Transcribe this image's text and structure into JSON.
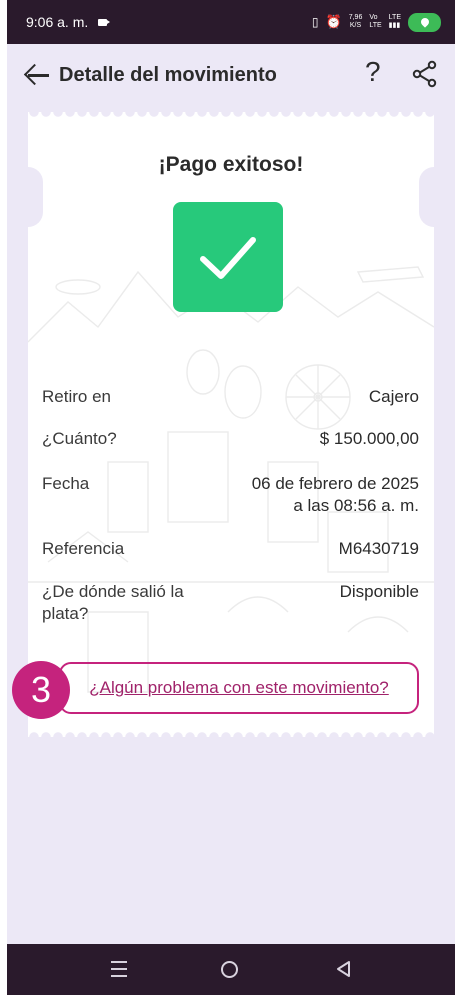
{
  "status_bar": {
    "time": "9:06 a. m.",
    "speed_value": "7,96",
    "speed_unit": "K/S",
    "net_1": "Vo",
    "net_2": "LTE",
    "net_3": "LTE"
  },
  "header": {
    "title": "Detalle del movimiento",
    "help_glyph": "?"
  },
  "ticket": {
    "heading": "¡Pago exitoso!",
    "rows": [
      {
        "label": "Retiro en",
        "value": "Cajero"
      },
      {
        "label": "¿Cuánto?",
        "value": "$ 150.000,00"
      },
      {
        "label": "Fecha",
        "value": "06 de febrero de 2025",
        "value2": "a las 08:56 a. m."
      },
      {
        "label": "Referencia",
        "value": "M6430719"
      },
      {
        "label": "¿De dónde salió la plata?",
        "value": "Disponible"
      }
    ],
    "problem_link": "¿Algún problema con este movimiento?"
  },
  "step_badge": "3",
  "colors": {
    "accent": "#c5237d",
    "success": "#27c97b",
    "background": "#ece8f6",
    "bars": "#2a1a2c"
  },
  "icons": [
    "back-arrow-icon",
    "help-icon",
    "share-icon",
    "check-icon",
    "menu-icon",
    "home-icon",
    "back-triangle-icon"
  ]
}
